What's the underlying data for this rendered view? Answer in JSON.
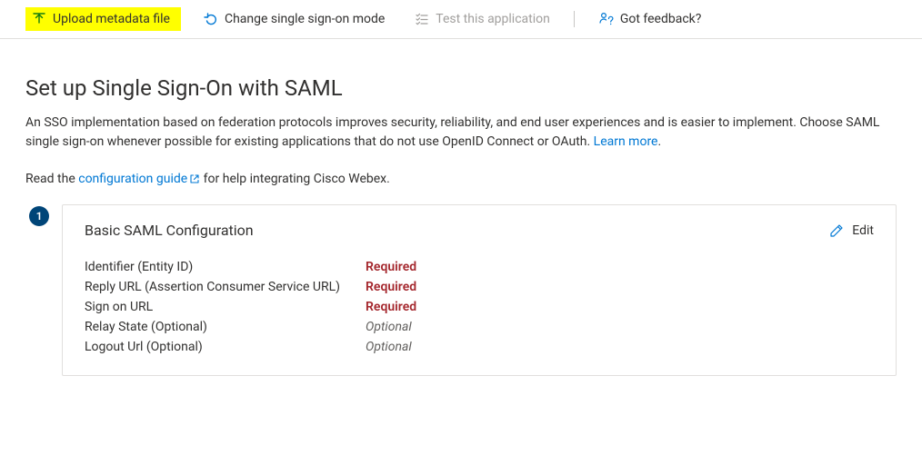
{
  "toolbar": {
    "upload": "Upload metadata file",
    "change": "Change single sign-on mode",
    "test": "Test this application",
    "feedback": "Got feedback?"
  },
  "page": {
    "title": "Set up Single Sign-On with SAML",
    "desc_pre": "An SSO implementation based on federation protocols improves security, reliability, and end user experiences and is easier to implement. Choose SAML single sign-on whenever possible for existing applications that do not use OpenID Connect or OAuth. ",
    "learn_more": "Learn more",
    "desc_post": ".",
    "read_pre": "Read the ",
    "config_guide": "configuration guide",
    "read_post": " for help integrating Cisco Webex."
  },
  "card": {
    "step": "1",
    "title": "Basic SAML Configuration",
    "edit": "Edit",
    "fields": [
      {
        "label": "Identifier (Entity ID)",
        "value": "Required",
        "kind": "required"
      },
      {
        "label": "Reply URL (Assertion Consumer Service URL)",
        "value": "Required",
        "kind": "required"
      },
      {
        "label": "Sign on URL",
        "value": "Required",
        "kind": "required"
      },
      {
        "label": "Relay State (Optional)",
        "value": "Optional",
        "kind": "optional"
      },
      {
        "label": "Logout Url (Optional)",
        "value": "Optional",
        "kind": "optional"
      }
    ]
  }
}
